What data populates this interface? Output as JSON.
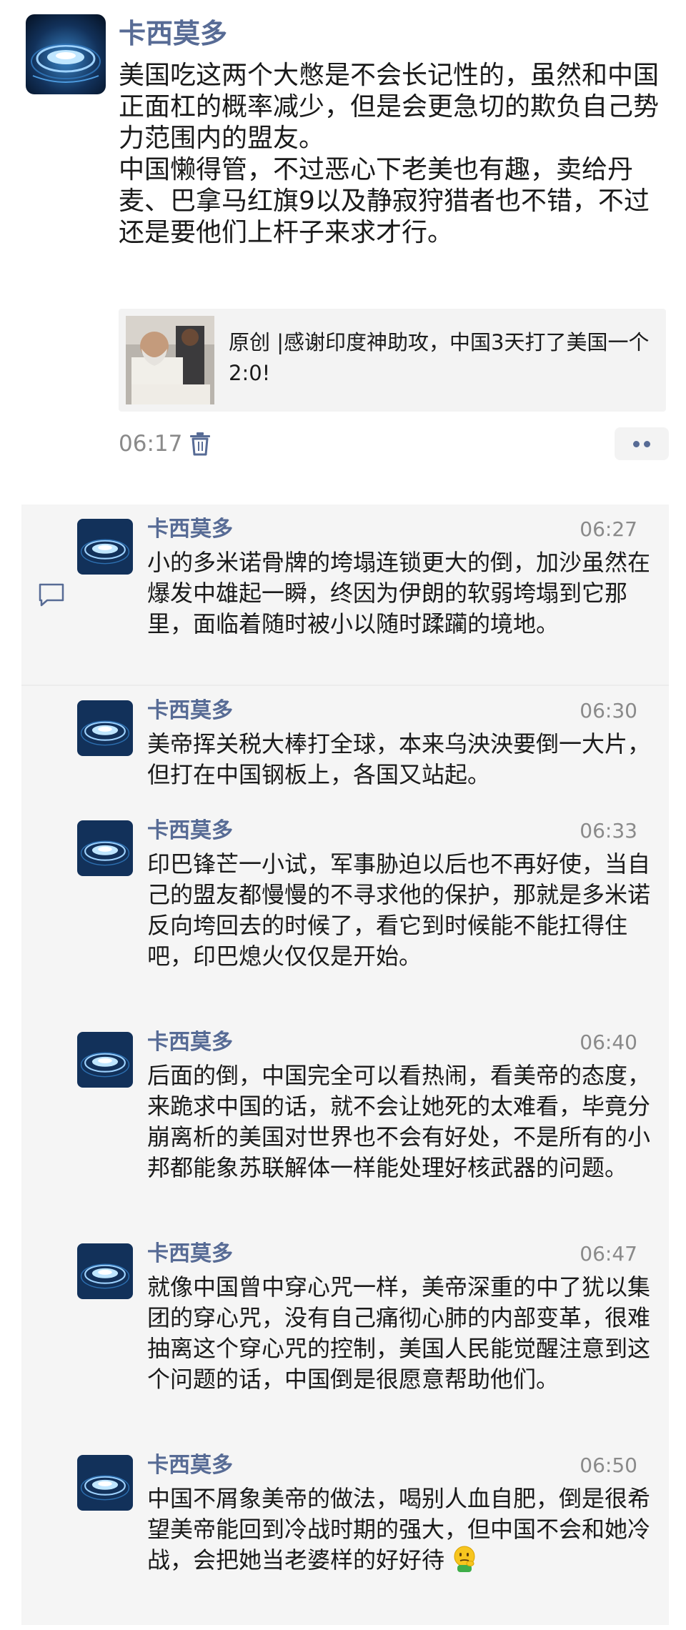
{
  "post": {
    "author": "卡西莫多",
    "paragraphs": [
      "美国吃这两个大憋是不会长记性的，虽然和中国正面杠的概率减少，但是会更急切的欺负自己势力范围内的盟友。",
      "中国懒得管，不过恶心下老美也有趣，卖给丹麦、巴拿马红旗9以及静寂狩猎者也不错，不过还是要他们上杆子来求才行。"
    ],
    "link": {
      "title": "原创 |感谢印度神助攻，中国3天打了美国一个2:0!"
    },
    "time": "06:17"
  },
  "comments": [
    {
      "author": "卡西莫多",
      "time": "06:27",
      "text": "小的多米诺骨牌的垮塌连锁更大的倒，加沙虽然在爆发中雄起一瞬，终因为伊朗的软弱垮塌到它那里，面临着随时被小以随时蹂躏的境地。"
    },
    {
      "author": "卡西莫多",
      "time": "06:30",
      "text": "美帝挥关税大棒打全球，本来乌泱泱要倒一大片，但打在中国钢板上，各国又站起。"
    },
    {
      "author": "卡西莫多",
      "time": "06:33",
      "text": "印巴锋芒一小试，军事胁迫以后也不再好使，当自己的盟友都慢慢的不寻求他的保护，那就是多米诺反向垮回去的时候了，看它到时候能不能扛得住吧，印巴熄火仅仅是开始。"
    },
    {
      "author": "卡西莫多",
      "time": "06:40",
      "text": "后面的倒，中国完全可以看热闹，看美帝的态度，来跪求中国的话，就不会让她死的太难看，毕竟分崩离析的美国对世界也不会有好处，不是所有的小邦都能象苏联解体一样能处理好核武器的问题。"
    },
    {
      "author": "卡西莫多",
      "time": "06:47",
      "text": "就像中国曾中穿心咒一样，美帝深重的中了犹以集团的穿心咒，没有自己痛彻心肺的内部变革，很难抽离这个穿心咒的控制，美国人民能觉醒注意到这个问题的话，中国倒是很愿意帮助他们。"
    },
    {
      "author": "卡西莫多",
      "time": "06:50",
      "text": "中国不屑象美帝的做法，喝别人血自肥，倒是很希望美帝能回到冷战时期的强大，但中国不会和她冷战，会把她当老婆样的好好待",
      "emoji": "thinking-face"
    }
  ],
  "colors": {
    "name_blue": "#576b95",
    "timestamp_gray": "#8a8a8a",
    "comment_bg": "#f5f5f5",
    "card_bg": "#f3f3f3"
  }
}
